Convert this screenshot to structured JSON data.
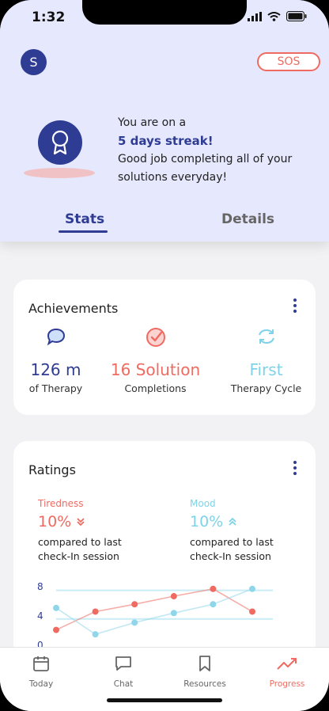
{
  "status_bar": {
    "time": "1:32"
  },
  "header": {
    "avatar_initial": "S",
    "sos_label": "SOS"
  },
  "streak": {
    "line1": "You are on a",
    "highlight": "5 days streak!",
    "line2": "Good job completing all of your solutions everyday!"
  },
  "tabs": [
    {
      "label": "Stats",
      "active": true
    },
    {
      "label": "Details",
      "active": false
    }
  ],
  "achievements": {
    "title": "Achievements",
    "items": [
      {
        "value": "126 m",
        "caption": "of Therapy",
        "icon": "chat-bubble-icon",
        "color": "#2f3c94"
      },
      {
        "value": "16 Solution",
        "caption": "Completions",
        "icon": "check-circle-icon",
        "color": "#ef6b61"
      },
      {
        "value": "First",
        "caption": "Therapy Cycle",
        "icon": "cycle-arrows-icon",
        "color": "#7fd3e8"
      }
    ]
  },
  "ratings": {
    "title": "Ratings",
    "tiredness": {
      "label": "Tiredness",
      "value": "10%",
      "note": "compared to last check-In session",
      "color": "#ef6b61",
      "trend": "down"
    },
    "mood": {
      "label": "Mood",
      "value": "10%",
      "note": "compared to last check-In session",
      "color": "#7fd3e8",
      "trend": "up"
    },
    "chart_data": {
      "type": "line",
      "y_ticks": [
        "8",
        "4",
        "0"
      ],
      "ylim": [
        0,
        8
      ],
      "reference_lines": [
        7.5,
        3.6
      ],
      "series": [
        {
          "color": "#ef6b61",
          "values": [
            2.1,
            4.6,
            5.6,
            6.7,
            7.7,
            4.6
          ]
        },
        {
          "color": "#8fd6ea",
          "values": [
            5.1,
            1.5,
            3.1,
            4.4,
            5.6,
            7.7
          ]
        }
      ]
    }
  },
  "nav": [
    {
      "label": "Today",
      "icon": "calendar-icon",
      "active": false
    },
    {
      "label": "Chat",
      "icon": "chat-icon",
      "active": false
    },
    {
      "label": "Resources",
      "icon": "bookmark-icon",
      "active": false
    },
    {
      "label": "Progress",
      "icon": "trending-up-icon",
      "active": true
    }
  ],
  "colors": {
    "primary": "#2f3c94",
    "accent": "#ef6b61",
    "mood": "#7fd3e8",
    "hero_bg": "#e6e8fd"
  }
}
